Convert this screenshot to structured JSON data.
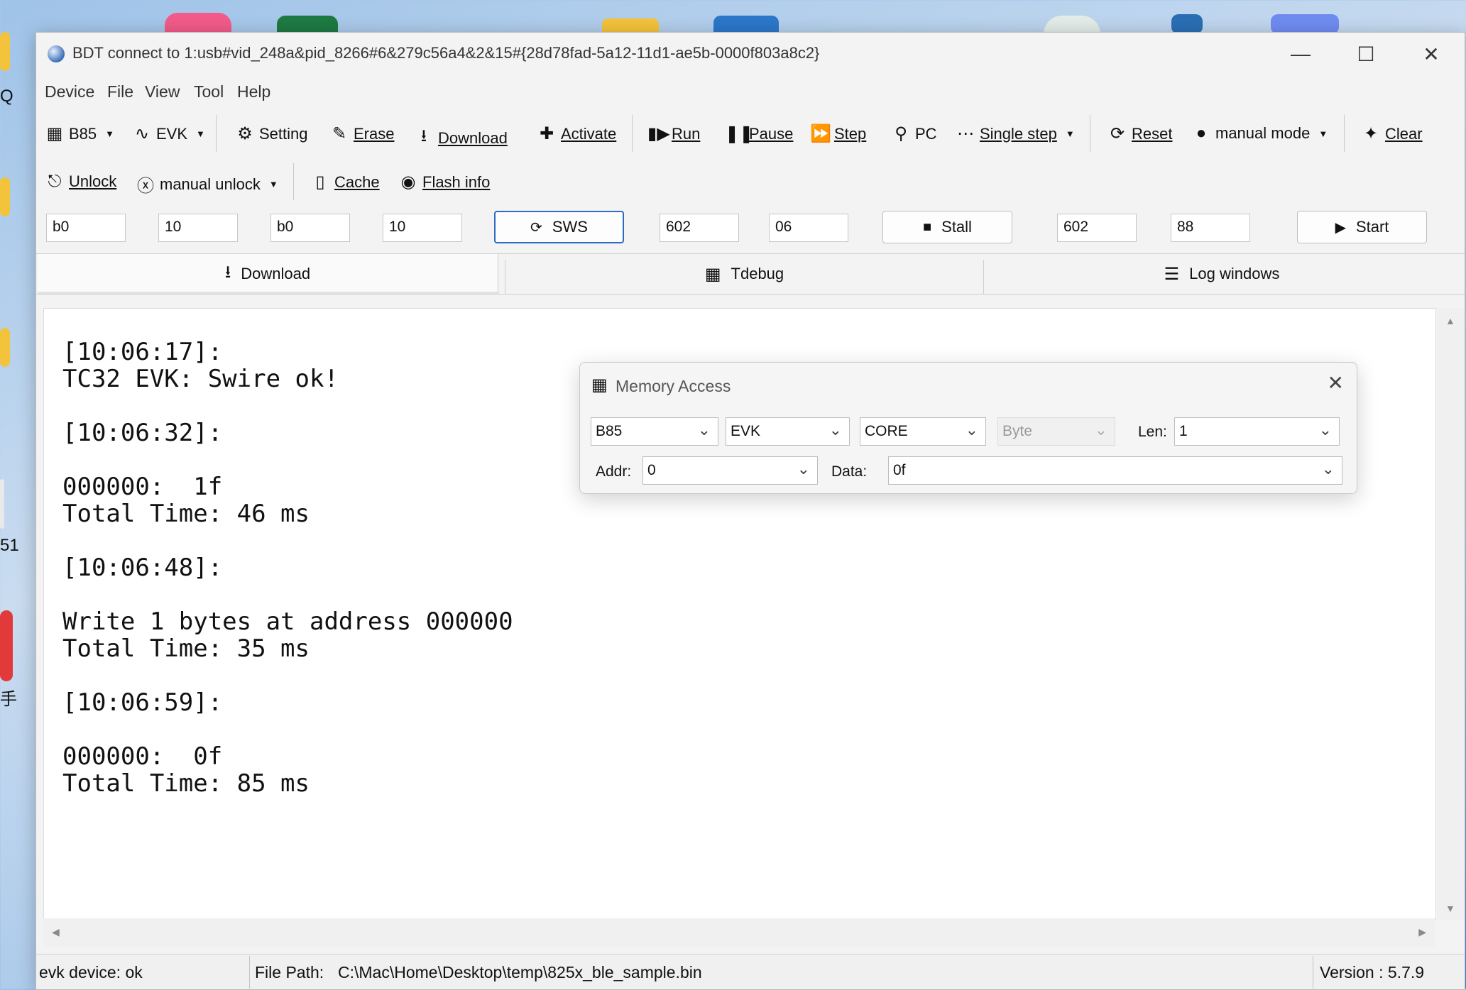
{
  "window": {
    "title": "BDT connect to 1:usb#vid_248a&pid_8266#6&279c56a4&2&15#{28d78fad-5a12-11d1-ae5b-0000f803a8c2}"
  },
  "menu": [
    "Device",
    "File",
    "View",
    "Tool",
    "Help"
  ],
  "toolbar1": {
    "chip": "B85",
    "board": "EVK",
    "setting": "Setting",
    "erase": "Erase",
    "download": "Download",
    "activate": "Activate",
    "run": "Run",
    "pause": "Pause",
    "step": "Step",
    "pc": "PC",
    "single_step": "Single step",
    "reset": "Reset",
    "mode": "manual mode",
    "clear": "Clear"
  },
  "toolbar2": {
    "unlock": "Unlock",
    "manual_unlock": "manual unlock",
    "cache": "Cache",
    "flash_info": "Flash info"
  },
  "params": {
    "f1": "b0",
    "f2": "10",
    "f3": "b0",
    "f4": "10",
    "sws": "SWS",
    "f5": "602",
    "f6": "06",
    "stall": "Stall",
    "f7": "602",
    "f8": "88",
    "start": "Start"
  },
  "tabs": [
    "Download",
    "Tdebug",
    "Log windows"
  ],
  "log": "[10:06:17]:\nTC32 EVK: Swire ok!\n\n[10:06:32]:\n\n000000:  1f\nTotal Time: 46 ms\n\n[10:06:48]:\n\nWrite 1 bytes at address 000000\nTotal Time: 35 ms\n\n[10:06:59]:\n\n000000:  0f\nTotal Time: 85 ms",
  "dialog": {
    "title": "Memory Access",
    "chip": "B85",
    "board": "EVK",
    "space": "CORE",
    "unit": "Byte",
    "len_label": "Len:",
    "len": "1",
    "addr_label": "Addr:",
    "addr": "0",
    "data_label": "Data:",
    "data": "0f"
  },
  "status": {
    "device": "evk device: ok",
    "file_path_label": "File Path:",
    "file_path": "C:\\Mac\\Home\\Desktop\\temp\\825x_ble_sample.bin",
    "version": "Version : 5.7.9"
  },
  "desktop_labels": [
    "Q",
    "51",
    "手"
  ]
}
